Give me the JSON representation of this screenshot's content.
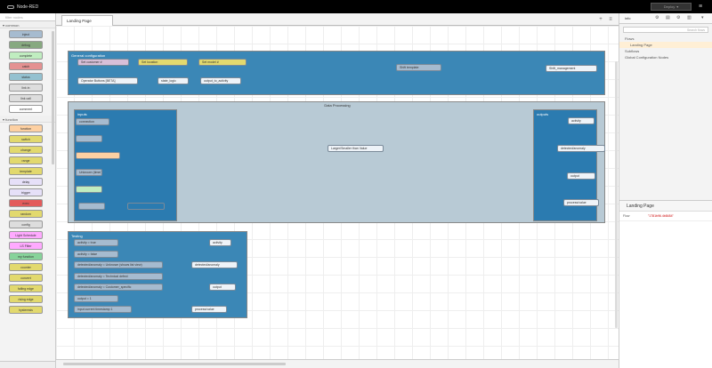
{
  "app": {
    "title": "Node-RED",
    "deploy_label": "Deploy"
  },
  "palette": {
    "search_placeholder": "filter nodes",
    "categories": [
      {
        "name": "common",
        "nodes": [
          {
            "label": "inject",
            "color": "#a6bbcf"
          },
          {
            "label": "debug",
            "color": "#87a980"
          },
          {
            "label": "complete",
            "color": "#c0edc0"
          },
          {
            "label": "catch",
            "color": "#e49191"
          },
          {
            "label": "status",
            "color": "#94c1d0"
          },
          {
            "label": "link in",
            "color": "#dddddd"
          },
          {
            "label": "link call",
            "color": "#dddddd"
          },
          {
            "label": "comment",
            "color": "#ffffff"
          }
        ]
      },
      {
        "name": "function",
        "nodes": [
          {
            "label": "function",
            "color": "#fdd0a2"
          },
          {
            "label": "switch",
            "color": "#e2d96e"
          },
          {
            "label": "change",
            "color": "#e2d96e"
          },
          {
            "label": "range",
            "color": "#e2d96e"
          },
          {
            "label": "template",
            "color": "#e2d96e"
          },
          {
            "label": "delay",
            "color": "#e6e0f8"
          },
          {
            "label": "trigger",
            "color": "#e6e0f8"
          },
          {
            "label": "exec",
            "color": "#e35b5b"
          },
          {
            "label": "random",
            "color": "#e2d96e"
          },
          {
            "label": "config",
            "color": "#dddddd"
          },
          {
            "label": "Light Schedule",
            "color": "#ffaaff"
          },
          {
            "label": "LS Filter",
            "color": "#ffaaff"
          },
          {
            "label": "my function",
            "color": "#87d39a"
          },
          {
            "label": "counter",
            "color": "#e2d96e"
          },
          {
            "label": "convert",
            "color": "#e2d96e"
          },
          {
            "label": "falling edge",
            "color": "#e2d96e"
          },
          {
            "label": "rising edge",
            "color": "#e2d96e"
          },
          {
            "label": "hysteresis",
            "color": "#e2d96e"
          }
        ]
      }
    ]
  },
  "workspace": {
    "tab_label": "Landing Page",
    "groups": {
      "config": "General configuration",
      "processing": "Data Processing",
      "inputs": "inputs",
      "outputs": "outputs",
      "testing": "Testing"
    },
    "config_nodes": {
      "n1": "Set customer #",
      "n2": "Set location",
      "n3": "Set model #",
      "n4": "Operator Buttons [BETA]",
      "n5": "state_logic",
      "n6": "output_to_activity",
      "n7": "Shift template",
      "n8": "Shift_management"
    },
    "input_nodes": [
      "connection",
      "",
      "",
      "Unknown (timer)",
      "",
      "",
      "",
      ""
    ],
    "output_nodes": [
      "activity",
      "detected/anomaly",
      "output",
      "process/value"
    ],
    "switch_label": "Larger/Smaller than Value",
    "testing_nodes": [
      "activity = true",
      "activity = false",
      "detected/anomaly = Unknown (shows list view)",
      "detected/anomaly = Technical defect",
      "detected/anomaly = Customer_specific",
      "output = 1",
      "input current timestamp 1"
    ],
    "testing_outputs": [
      "activity",
      "detected/anomaly",
      "output",
      "process/value"
    ]
  },
  "sidebar": {
    "tab_label": "info",
    "search_placeholder": "Search flows",
    "tree": [
      "Flows",
      "Landing Page",
      "Subflows",
      "Global Configuration Nodes"
    ],
    "info_title": "Landing Page",
    "prop_key": "Flow",
    "prop_value": "\"1781b96.4b8484\""
  }
}
